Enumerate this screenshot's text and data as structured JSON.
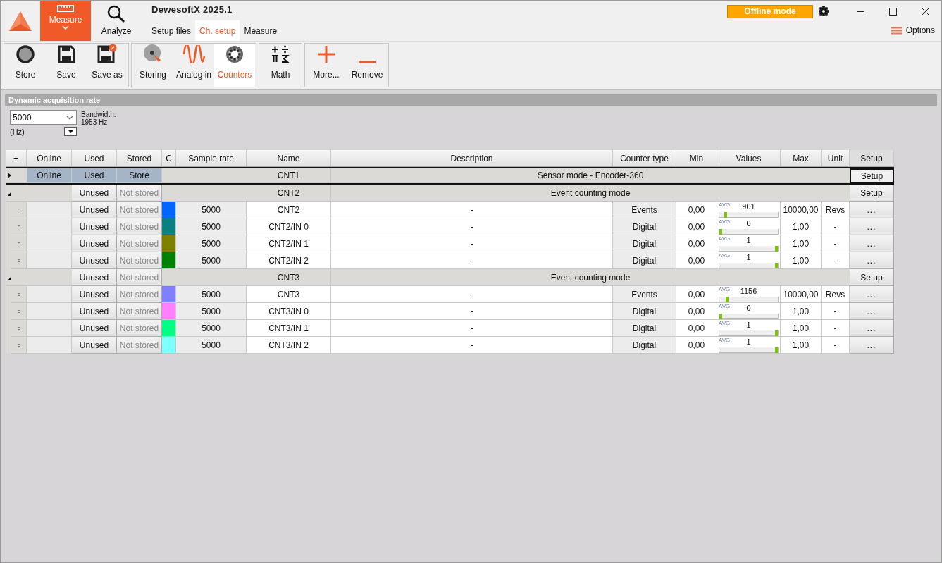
{
  "app": {
    "title": "DewesoftX 2025.1",
    "mode_badge": "Offline mode",
    "options": "Options"
  },
  "main_tabs": [
    {
      "label": "Measure",
      "selected": true
    },
    {
      "label": "Analyze",
      "selected": false
    }
  ],
  "sub_tabs": [
    {
      "label": "Setup files",
      "selected": false
    },
    {
      "label": "Ch. setup",
      "selected": true
    },
    {
      "label": "Measure",
      "selected": false
    }
  ],
  "toolbar_groups": [
    [
      {
        "label": "Store",
        "selected": false
      },
      {
        "label": "Save",
        "selected": false
      },
      {
        "label": "Save as",
        "selected": false
      }
    ],
    [
      {
        "label": "Storing",
        "selected": false
      },
      {
        "label": "Analog in",
        "selected": false
      },
      {
        "label": "Counters",
        "selected": true
      }
    ],
    [
      {
        "label": "Math",
        "selected": false
      }
    ],
    [
      {
        "label": "More...",
        "selected": false
      },
      {
        "label": "Remove",
        "selected": false
      }
    ]
  ],
  "acquisition": {
    "title": "Dynamic acquisition rate",
    "rate": "5000",
    "unit": "(Hz)",
    "bandwidth_label": "Bandwidth:",
    "bandwidth": "1953 Hz"
  },
  "table": {
    "columns": [
      "+",
      "Online",
      "Used",
      "Stored",
      "C",
      "Sample rate",
      "Name",
      "Description",
      "Counter type",
      "Min",
      "Values",
      "Max",
      "Unit",
      "Setup"
    ],
    "rows": [
      {
        "expanded": false,
        "selected": true,
        "online": "Online",
        "used": "Used",
        "stored": "Store",
        "stored_on": true,
        "name": "CNT1",
        "description": "Sensor mode - Encoder-360",
        "setup": "Setup"
      },
      {
        "expanded": true,
        "selected": false,
        "used": "Unused",
        "stored": "Not stored",
        "stored_on": false,
        "name": "CNT2",
        "description": "Event counting mode",
        "setup": "Setup",
        "children": [
          {
            "used": "Unused",
            "stored": "Not stored",
            "stored_on": false,
            "color": "#0066ff",
            "sample_rate": "5000",
            "name": "CNT2",
            "description": "-",
            "counter_type": "Events",
            "min": "0,00",
            "value_label": "AVG",
            "value": "901",
            "level": 0.09,
            "max": "10000,00",
            "unit": "Revs",
            "setup": "..."
          },
          {
            "used": "Unused",
            "stored": "Not stored",
            "stored_on": false,
            "color": "#0b8080",
            "sample_rate": "5000",
            "name": "CNT2/IN 0",
            "description": "-",
            "counter_type": "Digital",
            "min": "0,00",
            "value_label": "AVG",
            "value": "0",
            "level": 0,
            "max": "1,00",
            "unit": "-",
            "setup": "..."
          },
          {
            "used": "Unused",
            "stored": "Not stored",
            "stored_on": false,
            "color": "#808000",
            "sample_rate": "5000",
            "name": "CNT2/IN 1",
            "description": "-",
            "counter_type": "Digital",
            "min": "0,00",
            "value_label": "AVG",
            "value": "1",
            "level": 1,
            "max": "1,00",
            "unit": "-",
            "setup": "..."
          },
          {
            "used": "Unused",
            "stored": "Not stored",
            "stored_on": false,
            "color": "#008000",
            "sample_rate": "5000",
            "name": "CNT2/IN 2",
            "description": "-",
            "counter_type": "Digital",
            "min": "0,00",
            "value_label": "AVG",
            "value": "1",
            "level": 1,
            "max": "1,00",
            "unit": "-",
            "setup": "..."
          }
        ]
      },
      {
        "expanded": true,
        "selected": false,
        "used": "Unused",
        "stored": "Not stored",
        "stored_on": false,
        "name": "CNT3",
        "description": "Event counting mode",
        "setup": "Setup",
        "children": [
          {
            "used": "Unused",
            "stored": "Not stored",
            "stored_on": false,
            "color": "#8080ff",
            "sample_rate": "5000",
            "name": "CNT3",
            "description": "-",
            "counter_type": "Events",
            "min": "0,00",
            "value_label": "AVG",
            "value": "1156",
            "level": 0.12,
            "max": "10000,00",
            "unit": "Revs",
            "setup": "..."
          },
          {
            "used": "Unused",
            "stored": "Not stored",
            "stored_on": false,
            "color": "#ff80ff",
            "sample_rate": "5000",
            "name": "CNT3/IN 0",
            "description": "-",
            "counter_type": "Digital",
            "min": "0,00",
            "value_label": "AVG",
            "value": "0",
            "level": 0,
            "max": "1,00",
            "unit": "-",
            "setup": "..."
          },
          {
            "used": "Unused",
            "stored": "Not stored",
            "stored_on": false,
            "color": "#00ff80",
            "sample_rate": "5000",
            "name": "CNT3/IN 1",
            "description": "-",
            "counter_type": "Digital",
            "min": "0,00",
            "value_label": "AVG",
            "value": "1",
            "level": 1,
            "max": "1,00",
            "unit": "-",
            "setup": "..."
          },
          {
            "used": "Unused",
            "stored": "Not stored",
            "stored_on": false,
            "color": "#80ffff",
            "sample_rate": "5000",
            "name": "CNT3/IN 2",
            "description": "-",
            "counter_type": "Digital",
            "min": "0,00",
            "value_label": "AVG",
            "value": "1",
            "level": 1,
            "max": "1,00",
            "unit": "-",
            "setup": "..."
          }
        ]
      }
    ]
  }
}
